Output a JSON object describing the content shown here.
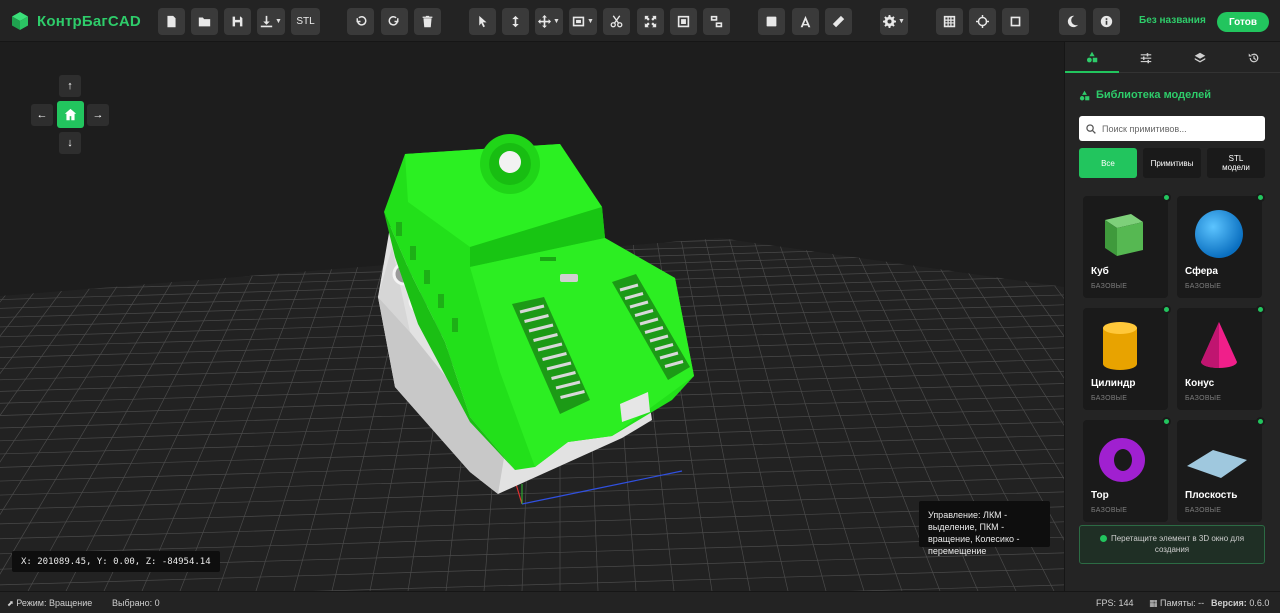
{
  "app": {
    "name": "КонтрБагCAD",
    "project_name": "Без названия",
    "done_label": "Готов"
  },
  "toolbar": {
    "stl_label": "STL",
    "icons": [
      "new-file-icon",
      "open-folder-icon",
      "save-icon",
      "download-icon",
      "export-stl-icon",
      "undo-icon",
      "redo-icon",
      "delete-icon",
      "select-pointer-icon",
      "move-vertical-icon",
      "move-cross-icon",
      "transform-icon",
      "scissors-icon",
      "fit-view-icon",
      "group-icon",
      "ungroup-icon",
      "solid-view-icon",
      "wireframe-icon",
      "ruler-icon",
      "settings-icon",
      "grid-icon",
      "snap-target-icon",
      "frame-icon",
      "dark-mode-icon",
      "info-icon"
    ]
  },
  "viewport": {
    "coords_text": "X: 201089.45, Y: 0.00, Z: -84954.14",
    "hint_text": "Управление: ЛКМ - выделение, ПКМ - вращение, Колесико - перемещение"
  },
  "panel": {
    "title": "Библиотека моделей",
    "search_placeholder": "Поиск примитивов...",
    "filters": [
      "Все",
      "Примитивы",
      "STL модели"
    ],
    "items": [
      {
        "name": "Куб",
        "category": "БАЗОВЫЕ",
        "shape": "cube"
      },
      {
        "name": "Сфера",
        "category": "БАЗОВЫЕ",
        "shape": "sphere"
      },
      {
        "name": "Цилиндр",
        "category": "БАЗОВЫЕ",
        "shape": "cylinder"
      },
      {
        "name": "Конус",
        "category": "БАЗОВЫЕ",
        "shape": "cone"
      },
      {
        "name": "Тор",
        "category": "БАЗОВЫЕ",
        "shape": "torus"
      },
      {
        "name": "Плоскость",
        "category": "БАЗОВЫЕ",
        "shape": "plane"
      }
    ],
    "tip": "Перетащите элемент в 3D окно для создания"
  },
  "status": {
    "mode": "Режим: Вращение",
    "selected": "Выбрано: 0",
    "fps": "FPS: 144",
    "memory": "Памяты: --",
    "version_label": "Версия:",
    "version": "0.6.0"
  },
  "colors": {
    "accent": "#22c55e",
    "model_green": "#22e61a",
    "model_white": "#e4e4e4"
  }
}
